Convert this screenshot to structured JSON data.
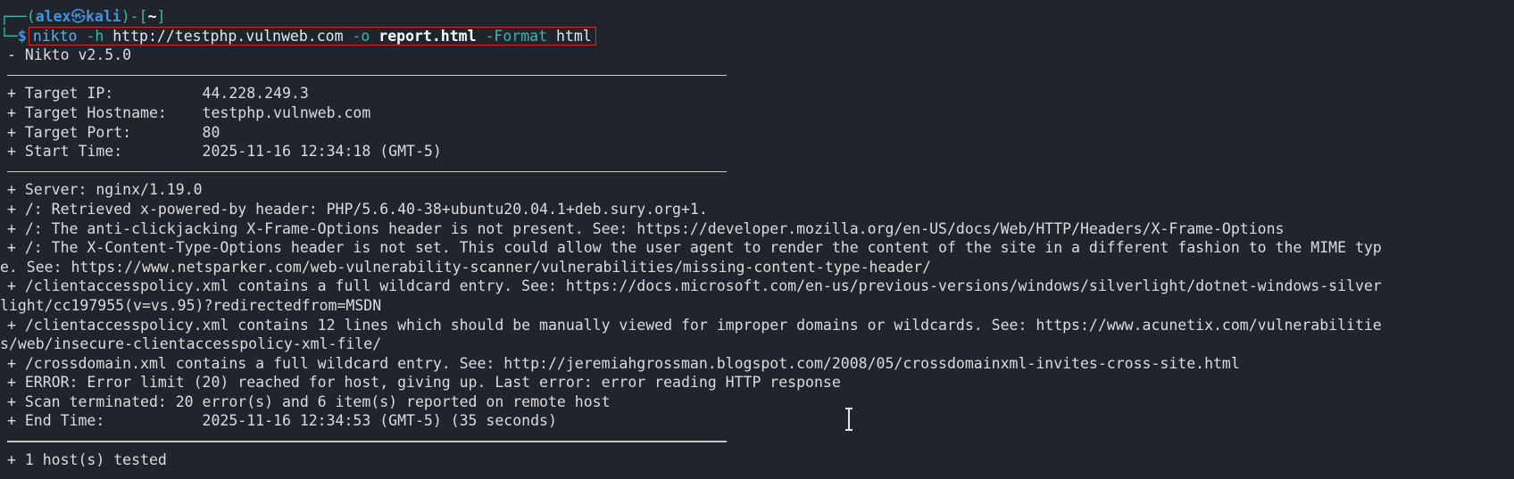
{
  "prompt": {
    "frame_top": "┌──(",
    "user": "alex",
    "at": "㉿",
    "host": "kali",
    "frame_mid": ")-[",
    "path": "~",
    "frame_end": "]",
    "frame_bottom": "└─",
    "dollar": "$"
  },
  "command": {
    "program": "nikto",
    "flag_h": "-h",
    "target": "http://testphp.vulnweb.com",
    "flag_o": "-o",
    "output_file": "report.html",
    "flag_format": "-Format",
    "format": "html"
  },
  "output": {
    "version": "- Nikto v2.5.0",
    "target_ip": "+ Target IP:          44.228.249.3",
    "target_hostname": "+ Target Hostname:    testphp.vulnweb.com",
    "target_port": "+ Target Port:        80",
    "start_time": "+ Start Time:         2025-11-16 12:34:18 (GMT-5)",
    "findings": [
      "+ Server: nginx/1.19.0",
      "+ /: Retrieved x-powered-by header: PHP/5.6.40-38+ubuntu20.04.1+deb.sury.org+1.",
      "+ /: The anti-clickjacking X-Frame-Options header is not present. See: https://developer.mozilla.org/en-US/docs/Web/HTTP/Headers/X-Frame-Options",
      "+ /: The X-Content-Type-Options header is not set. This could allow the user agent to render the content of the site in a different fashion to the MIME typ",
      "e. See: https://www.netsparker.com/web-vulnerability-scanner/vulnerabilities/missing-content-type-header/",
      "+ /clientaccesspolicy.xml contains a full wildcard entry. See: https://docs.microsoft.com/en-us/previous-versions/windows/silverlight/dotnet-windows-silver",
      "light/cc197955(v=vs.95)?redirectedfrom=MSDN",
      "+ /clientaccesspolicy.xml contains 12 lines which should be manually viewed for improper domains or wildcards. See: https://www.acunetix.com/vulnerabilitie",
      "s/web/insecure-clientaccesspolicy-xml-file/",
      "+ /crossdomain.xml contains a full wildcard entry. See: http://jeremiahgrossman.blogspot.com/2008/05/crossdomainxml-invites-cross-site.html",
      "+ ERROR: Error limit (20) reached for host, giving up. Last error: error reading HTTP response",
      "+ Scan terminated: 20 error(s) and 6 item(s) reported on remote host",
      "+ End Time:           2025-11-16 12:34:53 (GMT-5) (35 seconds)"
    ],
    "summary": "+ 1 host(s) tested"
  },
  "colors": {
    "background": "#20242d",
    "text": "#dcdcdc",
    "prompt_blue": "#3f95e0",
    "prompt_frame": "#3fb7a4",
    "highlight_box": "#d42a2a"
  }
}
